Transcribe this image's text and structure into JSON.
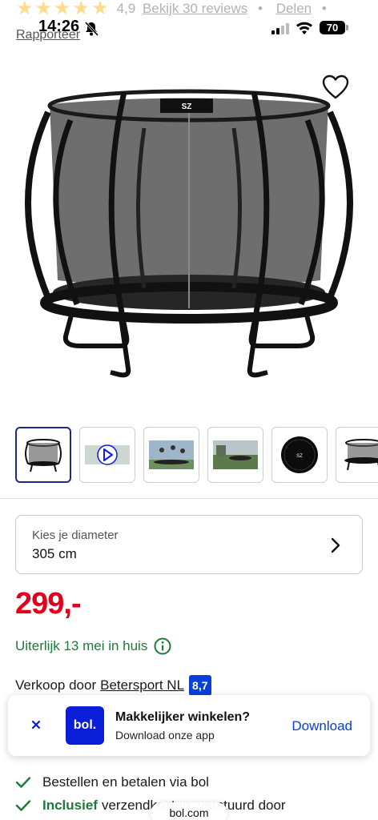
{
  "header": {
    "rating_value": "4,9",
    "reviews_link": "Bekijk 30 reviews",
    "separator": "•",
    "share_label": "Delen",
    "report_label": "Rapporteer"
  },
  "status_bar": {
    "time": "14:26",
    "battery": "70"
  },
  "product": {
    "thumbnails": [
      {
        "name": "thumb-trampoline"
      },
      {
        "name": "thumb-video"
      },
      {
        "name": "thumb-jumping"
      },
      {
        "name": "thumb-garden"
      },
      {
        "name": "thumb-top-view"
      },
      {
        "name": "thumb-side-view"
      }
    ],
    "diameter_label": "Kies je diameter",
    "diameter_value": "305 cm",
    "price": "299,-",
    "delivery": "Uiterlijk 13 mei in huis",
    "seller_prefix": "Verkoop door",
    "seller_name": "Betersport NL",
    "seller_score": "8,7"
  },
  "app_banner": {
    "logo_text": "bol.",
    "title": "Makkelijker winkelen?",
    "subtitle": "Download onze app",
    "download_label": "Download"
  },
  "usps": [
    {
      "highlight": "",
      "text": "Bestellen en betalen via bol"
    },
    {
      "highlight": "Inclusief",
      "text": "verzendkosten, verstuurd door"
    }
  ],
  "browser": {
    "url": "bol.com"
  },
  "colors": {
    "price_red": "#e3001b",
    "delivery_green": "#1e7a3a",
    "bol_blue": "#0a1ed8",
    "link_blue": "#0a3fd8"
  }
}
